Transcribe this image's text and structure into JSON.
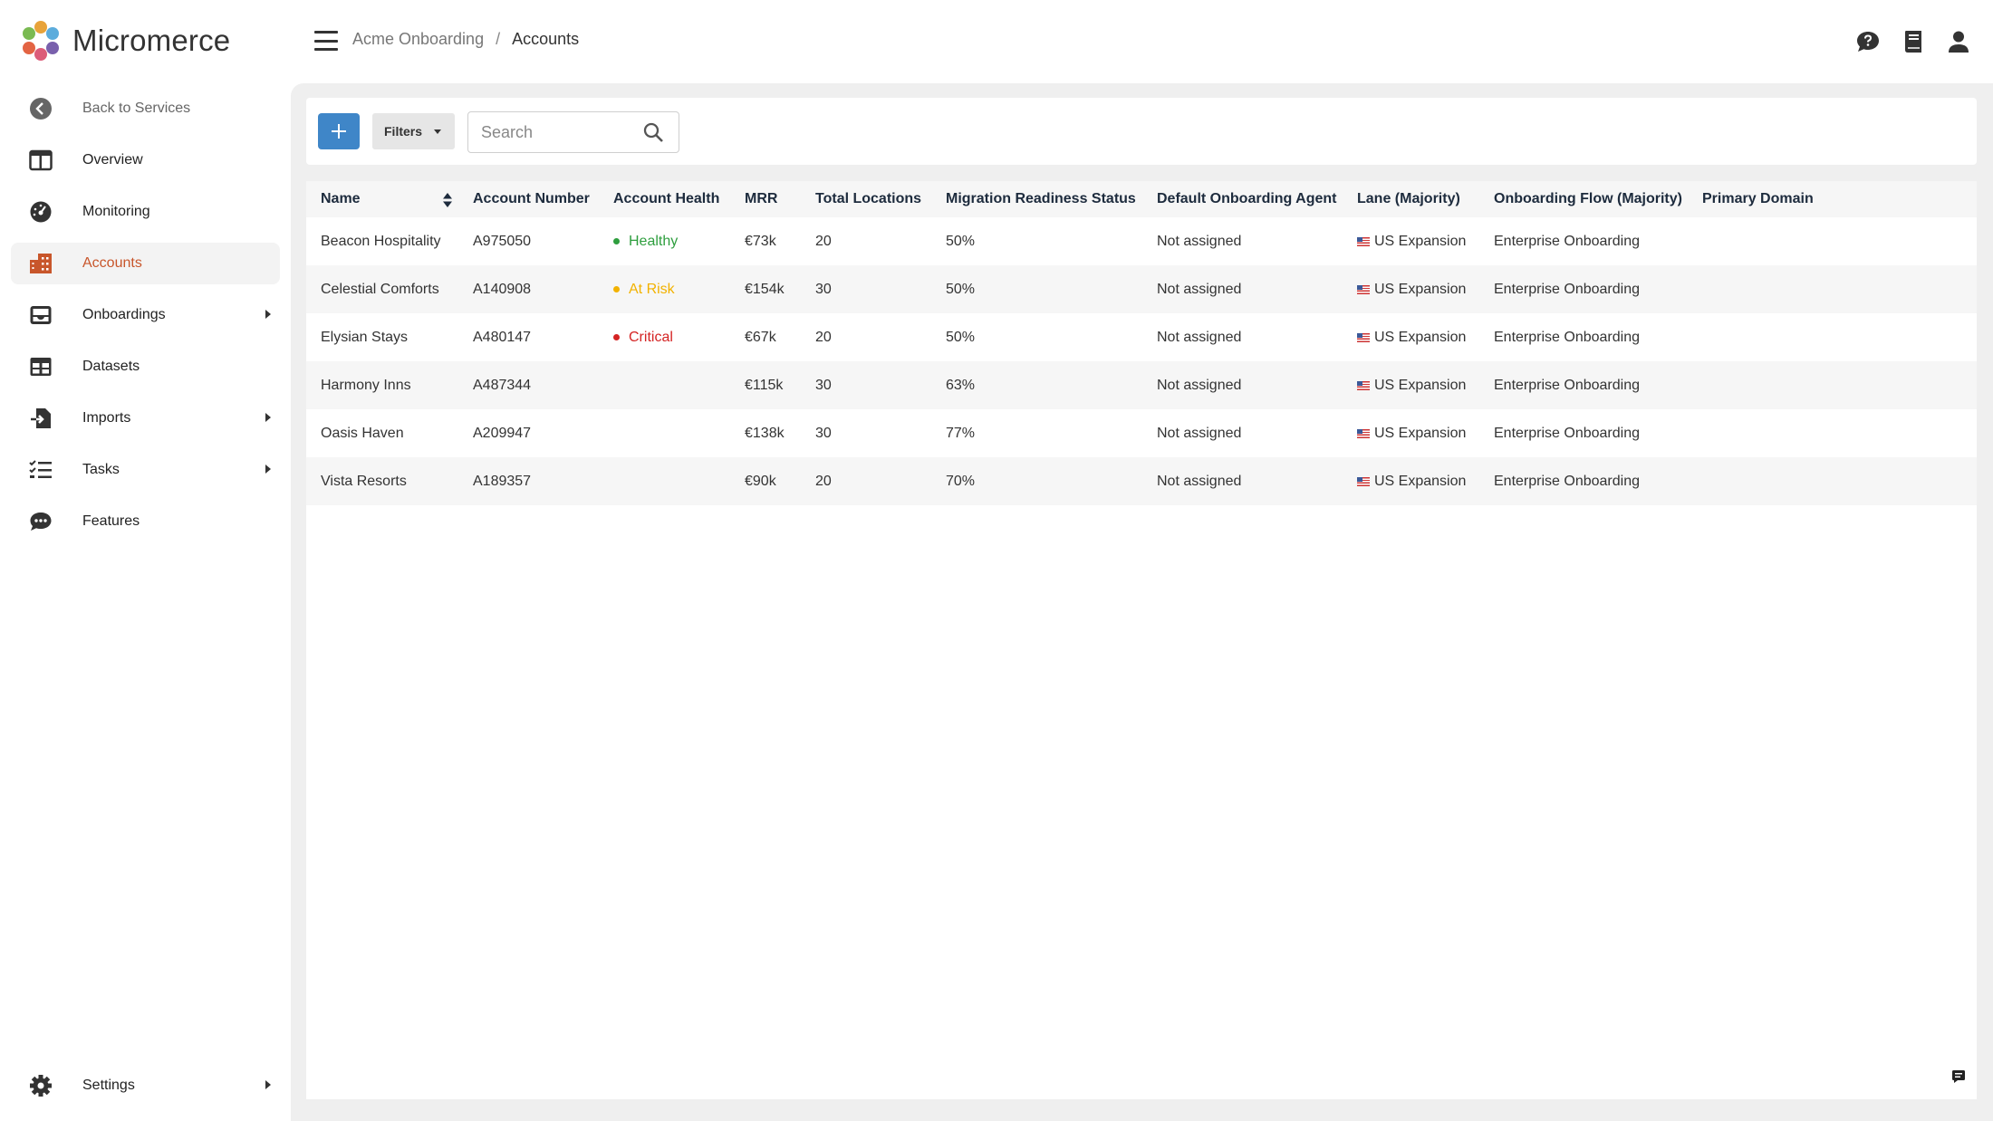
{
  "app": {
    "name": "Micromerce"
  },
  "sidebar": {
    "back": {
      "label": "Back to Services",
      "icon": "chevron-left-circle-icon"
    },
    "items": [
      {
        "label": "Overview",
        "icon": "layout-columns-icon"
      },
      {
        "label": "Monitoring",
        "icon": "speedometer-icon"
      },
      {
        "label": "Accounts",
        "icon": "building-icon",
        "active": true
      },
      {
        "label": "Onboardings",
        "icon": "inbox-icon",
        "expandable": true
      },
      {
        "label": "Datasets",
        "icon": "table-icon"
      },
      {
        "label": "Imports",
        "icon": "file-import-icon",
        "expandable": true
      },
      {
        "label": "Tasks",
        "icon": "checklist-icon",
        "expandable": true
      },
      {
        "label": "Features",
        "icon": "chat-bubble-icon"
      }
    ],
    "settings": {
      "label": "Settings",
      "icon": "gear-icon",
      "expandable": true
    }
  },
  "header": {
    "breadcrumb": [
      "Acme Onboarding",
      "Accounts"
    ],
    "separator": "/",
    "icons": [
      "help-chat-icon",
      "book-icon",
      "user-icon"
    ]
  },
  "toolbar": {
    "add_icon": "plus-icon",
    "filters_label": "Filters",
    "search_placeholder": "Search",
    "search_value": ""
  },
  "table": {
    "columns": [
      "Name",
      "Account Number",
      "Account Health",
      "MRR",
      "Total Locations",
      "Migration Readiness Status",
      "Default Onboarding Agent",
      "Lane (Majority)",
      "Onboarding Flow (Majority)",
      "Primary Domain"
    ],
    "rows": [
      {
        "name": "Beacon Hospitality",
        "account_number": "A975050",
        "health": "Healthy",
        "mrr": "€73k",
        "locations": "20",
        "readiness": "50%",
        "agent": "Not assigned",
        "lane": "US Expansion",
        "flow": "Enterprise Onboarding",
        "domain": ""
      },
      {
        "name": "Celestial Comforts",
        "account_number": "A140908",
        "health": "At Risk",
        "mrr": "€154k",
        "locations": "30",
        "readiness": "50%",
        "agent": "Not assigned",
        "lane": "US Expansion",
        "flow": "Enterprise Onboarding",
        "domain": ""
      },
      {
        "name": "Elysian Stays",
        "account_number": "A480147",
        "health": "Critical",
        "mrr": "€67k",
        "locations": "20",
        "readiness": "50%",
        "agent": "Not assigned",
        "lane": "US Expansion",
        "flow": "Enterprise Onboarding",
        "domain": ""
      },
      {
        "name": "Harmony Inns",
        "account_number": "A487344",
        "health": "",
        "mrr": "€115k",
        "locations": "30",
        "readiness": "63%",
        "agent": "Not assigned",
        "lane": "US Expansion",
        "flow": "Enterprise Onboarding",
        "domain": ""
      },
      {
        "name": "Oasis Haven",
        "account_number": "A209947",
        "health": "",
        "mrr": "€138k",
        "locations": "30",
        "readiness": "77%",
        "agent": "Not assigned",
        "lane": "US Expansion",
        "flow": "Enterprise Onboarding",
        "domain": ""
      },
      {
        "name": "Vista Resorts",
        "account_number": "A189357",
        "health": "",
        "mrr": "€90k",
        "locations": "20",
        "readiness": "70%",
        "agent": "Not assigned",
        "lane": "US Expansion",
        "flow": "Enterprise Onboarding",
        "domain": ""
      }
    ],
    "health_colors": {
      "Healthy": "#2e9e3e",
      "At Risk": "#f2b200",
      "Critical": "#d42323"
    }
  },
  "colors": {
    "accent": "#3f86c8",
    "active_nav": "#c8562b",
    "main_bg": "#efefef"
  }
}
